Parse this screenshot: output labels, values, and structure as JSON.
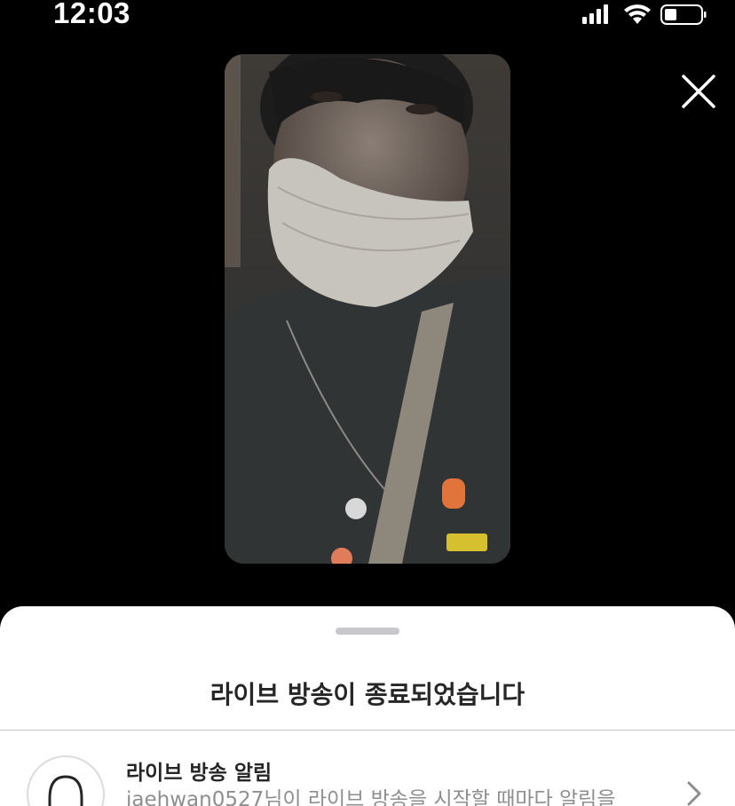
{
  "status_bar": {
    "time": "12:03",
    "icons": [
      "signal-icon",
      "wifi-icon",
      "battery-icon"
    ]
  },
  "live_ended": {
    "title": "라이브 방송이 종료되었습니다"
  },
  "notification": {
    "title": "라이브 방송 알림",
    "description": "jaehwan0527님이 라이브 방송을 시작할 때마다 알림을"
  },
  "colors": {
    "background": "#000000",
    "sheet": "#ffffff",
    "primary_text": "#262626",
    "secondary_text": "#8e8e8e"
  }
}
